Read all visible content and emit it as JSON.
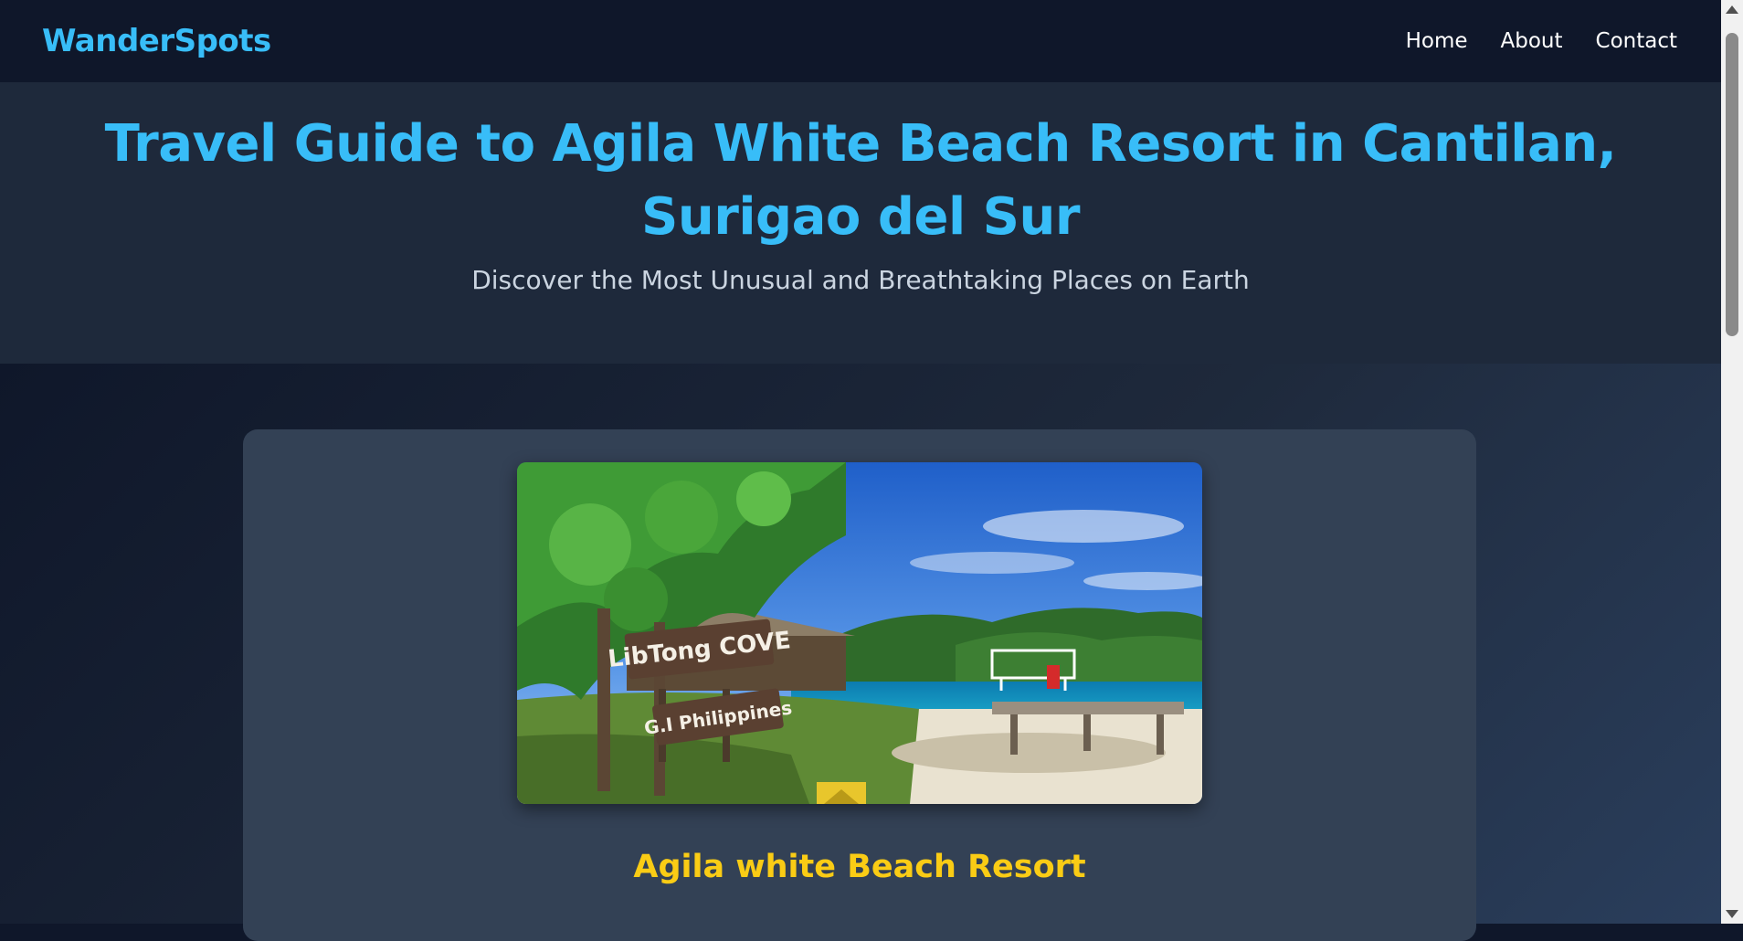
{
  "nav": {
    "brand": "WanderSpots",
    "links": [
      "Home",
      "About",
      "Contact"
    ]
  },
  "hero": {
    "title": "Travel Guide to Agila White Beach Resort in Cantilan, Surigao del Sur",
    "subtitle": "Discover the Most Unusual and Breathtaking Places on Earth"
  },
  "card": {
    "image_sign_top": "LibTong COVE",
    "image_sign_bottom": "G.I Philippines",
    "title": "Agila white Beach Resort"
  },
  "colors": {
    "accent": "#38bdf8",
    "highlight": "#facc15",
    "nav_bg": "#0f172a",
    "hero_bg": "#1e293b",
    "card_bg": "#334155"
  }
}
